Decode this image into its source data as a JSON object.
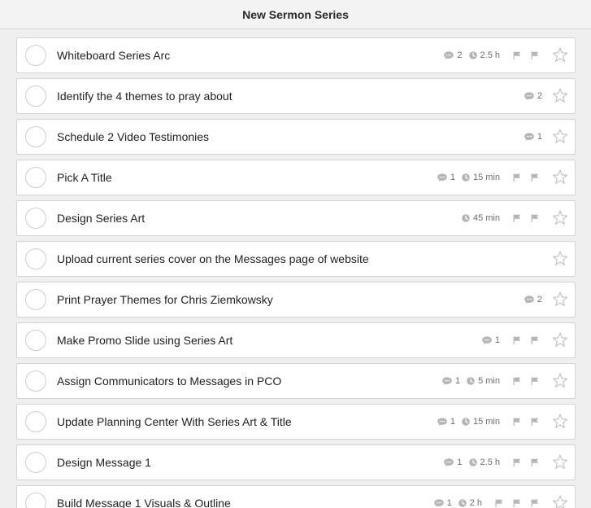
{
  "header": {
    "title": "New Sermon Series"
  },
  "tasks": [
    {
      "title": "Whiteboard Series Arc",
      "comments": "2",
      "time": "2.5 h",
      "flags": 2
    },
    {
      "title": "Identify the 4 themes to pray about",
      "comments": "2",
      "time": null,
      "flags": 0
    },
    {
      "title": "Schedule 2 Video Testimonies",
      "comments": "1",
      "time": null,
      "flags": 0
    },
    {
      "title": "Pick A Title",
      "comments": "1",
      "time": "15 min",
      "flags": 2
    },
    {
      "title": "Design Series Art",
      "comments": null,
      "time": "45 min",
      "flags": 2
    },
    {
      "title": "Upload current series cover on the Messages page of website",
      "comments": null,
      "time": null,
      "flags": 0
    },
    {
      "title": "Print Prayer Themes for Chris Ziemkowsky",
      "comments": "2",
      "time": null,
      "flags": 0
    },
    {
      "title": "Make Promo Slide using Series Art",
      "comments": "1",
      "time": null,
      "flags": 2
    },
    {
      "title": "Assign Communicators to Messages in PCO",
      "comments": "1",
      "time": "5 min",
      "flags": 2
    },
    {
      "title": "Update Planning Center With Series Art & Title",
      "comments": "1",
      "time": "15 min",
      "flags": 2
    },
    {
      "title": "Design Message 1",
      "comments": "1",
      "time": "2.5 h",
      "flags": 2
    },
    {
      "title": "Build Message 1 Visuals & Outline",
      "comments": "1",
      "time": "2 h",
      "flags": 3
    }
  ],
  "icons": {
    "comment": "comment-icon",
    "clock": "clock-icon",
    "flag": "flag-icon",
    "star": "star-icon",
    "check": "complete-circle"
  },
  "colors": {
    "background": "#efefef",
    "card": "#ffffff",
    "border": "#d4d4d4",
    "meta": "#6e6e6e",
    "icon": "#b5b5b5"
  }
}
